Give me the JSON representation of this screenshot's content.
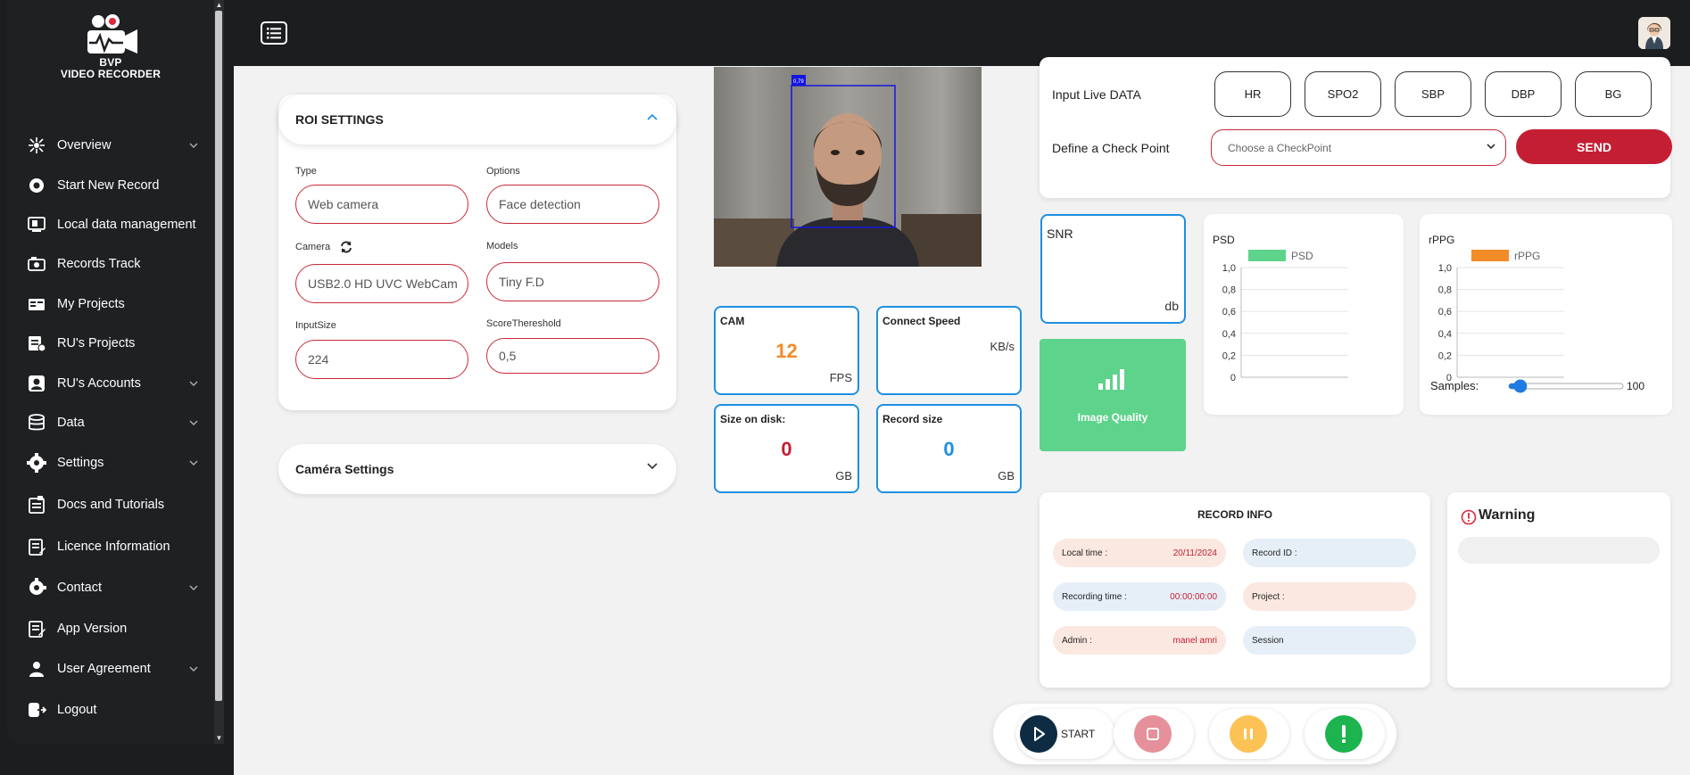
{
  "app": {
    "logo_line1": "BVP",
    "logo_line2": "VIDEO RECORDER"
  },
  "sidebar": {
    "items": [
      {
        "label": "Overview",
        "icon": "overview-icon",
        "has_chevron": true
      },
      {
        "label": "Start New Record",
        "icon": "record-icon",
        "has_chevron": false
      },
      {
        "label": "Local data management",
        "icon": "local-data-icon",
        "has_chevron": false
      },
      {
        "label": "Records Track",
        "icon": "records-track-icon",
        "has_chevron": false
      },
      {
        "label": "My Projects",
        "icon": "projects-icon",
        "has_chevron": false
      },
      {
        "label": "RU's Projects",
        "icon": "ru-projects-icon",
        "has_chevron": false
      },
      {
        "label": "RU's Accounts",
        "icon": "accounts-icon",
        "has_chevron": true
      },
      {
        "label": "Data",
        "icon": "data-icon",
        "has_chevron": true
      },
      {
        "label": "Settings",
        "icon": "gear-icon",
        "has_chevron": true
      },
      {
        "label": "Docs and Tutorials",
        "icon": "docs-icon",
        "has_chevron": false
      },
      {
        "label": "Licence Information",
        "icon": "licence-icon",
        "has_chevron": false
      },
      {
        "label": "Contact",
        "icon": "contact-icon",
        "has_chevron": true
      },
      {
        "label": "App Version",
        "icon": "app-version-icon",
        "has_chevron": false
      },
      {
        "label": "User Agreement",
        "icon": "user-icon",
        "has_chevron": true
      },
      {
        "label": "Logout",
        "icon": "logout-icon",
        "has_chevron": false
      }
    ]
  },
  "roi": {
    "title": "ROI SETTINGS",
    "type_label": "Type",
    "type_value": "Web camera",
    "options_label": "Options",
    "options_value": "Face detection",
    "camera_label": "Camera",
    "camera_value": "USB2.0 HD UVC WebCam",
    "models_label": "Models",
    "models_placeholder": "Tiny F.D",
    "input_size_label": "InputSize",
    "input_size_value": "224",
    "score_label": "ScoreThereshold",
    "score_value": "0,5"
  },
  "camera_settings": {
    "title": "Caméra Settings"
  },
  "video": {
    "detection_score": "0,79"
  },
  "stats": {
    "cam": {
      "label": "CAM",
      "value": "12",
      "unit": "FPS",
      "color": "#f28c28"
    },
    "speed": {
      "label": "Connect Speed",
      "value": "",
      "unit": "KB/s"
    },
    "disk": {
      "label": "Size on disk:",
      "value": "0",
      "unit": "GB",
      "color": "#c41e33"
    },
    "record": {
      "label": "Record size",
      "value": "0",
      "unit": "GB",
      "color": "#1e8fe1"
    }
  },
  "live_data": {
    "label": "Input Live DATA",
    "buttons": [
      "HR",
      "SPO2",
      "SBP",
      "DBP",
      "BG"
    ],
    "checkpoint_label": "Define a Check Point",
    "checkpoint_placeholder": "Choose a CheckPoint",
    "send_label": "SEND"
  },
  "snr": {
    "label": "SNR",
    "unit": "db"
  },
  "image_quality": {
    "label": "Image Quality",
    "color": "#5ed38b"
  },
  "chart_data": [
    {
      "type": "bar",
      "title": "PSD",
      "series": [
        {
          "name": "PSD",
          "values": [],
          "color": "#5ed38b"
        }
      ],
      "ylim": [
        0,
        1.0
      ],
      "ticks": [
        "1,0",
        "0,8",
        "0,6",
        "0,4",
        "0,2",
        "0"
      ],
      "grid": true,
      "legend": "top"
    },
    {
      "type": "bar",
      "title": "rPPG",
      "series": [
        {
          "name": "rPPG",
          "values": [],
          "color": "#f28c28"
        }
      ],
      "ylim": [
        0,
        1.0
      ],
      "ticks": [
        "1,0",
        "0,8",
        "0,6",
        "0,4",
        "0,2",
        "0"
      ],
      "grid": true,
      "legend": "top"
    }
  ],
  "samples": {
    "label": "Samples:",
    "value": "100",
    "slider_fraction": 0.1
  },
  "record_info": {
    "title": "RECORD INFO",
    "local_time_label": "Local time :",
    "local_time_value": "20/11/2024",
    "record_id_label": "Record ID :",
    "recording_time_label": "Recording time :",
    "recording_time_value": "00:00:00:00",
    "project_label": "Project :",
    "admin_label": "Admin :",
    "admin_value": "manel amri",
    "session_label": "Session"
  },
  "warning": {
    "title": "Warning"
  },
  "controls": {
    "start_label": "START"
  }
}
